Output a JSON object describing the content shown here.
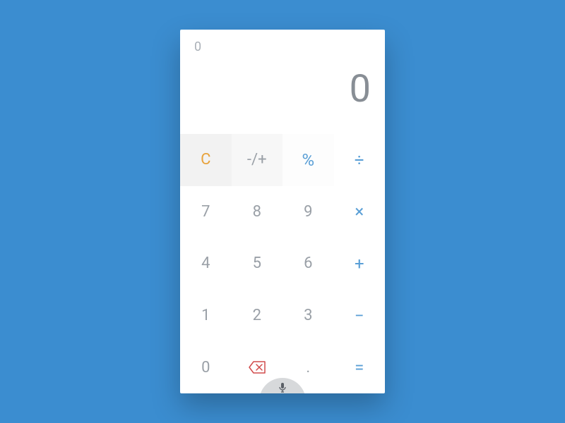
{
  "display": {
    "secondary": "0",
    "primary": "0"
  },
  "keys": {
    "clear": "C",
    "sign": "-/+",
    "percent": "%",
    "divide": "÷",
    "n7": "7",
    "n8": "8",
    "n9": "9",
    "multiply": "×",
    "n4": "4",
    "n5": "5",
    "n6": "6",
    "plus": "+",
    "n1": "1",
    "n2": "2",
    "n3": "3",
    "minus": "−",
    "n0": "0",
    "decimal": ".",
    "equals": "="
  }
}
